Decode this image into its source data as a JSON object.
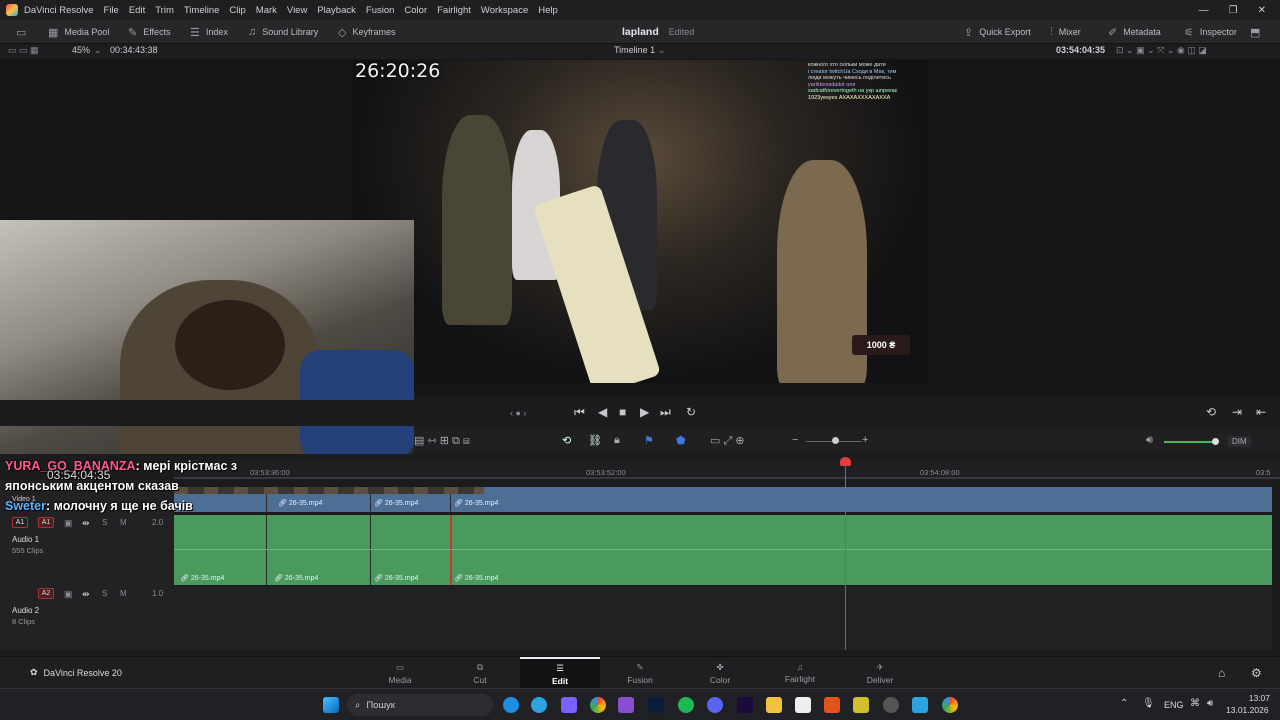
{
  "menubar": {
    "app_title": "DaVinci Resolve",
    "items": [
      "File",
      "Edit",
      "Trim",
      "Timeline",
      "Clip",
      "Mark",
      "View",
      "Playback",
      "Fusion",
      "Color",
      "Fairlight",
      "Workspace",
      "Help"
    ],
    "controls": [
      "—",
      "❐",
      "✕"
    ]
  },
  "toolbar": {
    "media_pool": "Media Pool",
    "effects": "Effects",
    "index": "Index",
    "sound_library": "Sound Library",
    "keyframes": "Keyframes",
    "project_name": "lapland",
    "project_status": "Edited",
    "quick_export": "Quick Export",
    "mixer": "Mixer",
    "metadata": "Metadata",
    "inspector": "Inspector"
  },
  "viewer": {
    "zoom": "45%",
    "source_timecode": "00:34:43:38",
    "timeline_name": "Timeline 1",
    "record_timecode": "03:54:04:35",
    "overlay_timecode": "26:20:26",
    "donation": "1000 ₴",
    "chat_lines": [
      "кожного хто скільки може дати",
      "і creator twitchUa Сходи в Мак, тим",
      "люди можуть чимось поділитись",
      "yarikbossdaitot оля",
      "sadcatforevertogeth на укр шпрехає",
      "1923yesyes АХАХАХХХАХАХХА"
    ]
  },
  "timeline": {
    "ruler": [
      {
        "label": "03:53:36:00"
      },
      {
        "label": "03:53:52:00"
      },
      {
        "label": "03:54:08:00"
      },
      {
        "label": "03:5"
      }
    ],
    "tracks": {
      "v1": {
        "name": "Video 1"
      },
      "a1": {
        "id": "A1",
        "patch": "A1",
        "name": "Audio 1",
        "clips_count": "555 Clips",
        "level": "2.0",
        "s": "S",
        "m": "M"
      },
      "a2": {
        "id": "A2",
        "name": "Audio 2",
        "clips_count": "8 Clips",
        "level": "1.0",
        "s": "S",
        "m": "M"
      }
    },
    "clips": [
      {
        "name": "26-35.mp4"
      },
      {
        "name": "26-35.mp4"
      },
      {
        "name": "26-35.mp4"
      },
      {
        "name": "26-35.mp4"
      }
    ],
    "dim": "DIM"
  },
  "chat_overlay": {
    "line1_user": "YURA_GO_BANANZA",
    "line1_text": ": мері крістмас з",
    "line2_text": "японським акцентом сказав",
    "overlay_tc": "03:54:04:35",
    "line3_user": "Sweter",
    "line3_text": ": молочну я ще не бачів"
  },
  "pages": {
    "brand": "DaVinci Resolve 20",
    "tabs": [
      "Media",
      "Cut",
      "Edit",
      "Fusion",
      "Color",
      "Fairlight",
      "Deliver"
    ],
    "active": "Edit"
  },
  "taskbar": {
    "search_placeholder": "Пошук",
    "lang": "ENG",
    "time": "13:07",
    "date": "13.01.2026"
  },
  "colors": {
    "accent": "#e53b3b",
    "video_track": "#4d6f96",
    "audio_track": "#4b9a5d",
    "chat_username": "#ff5a8a"
  }
}
